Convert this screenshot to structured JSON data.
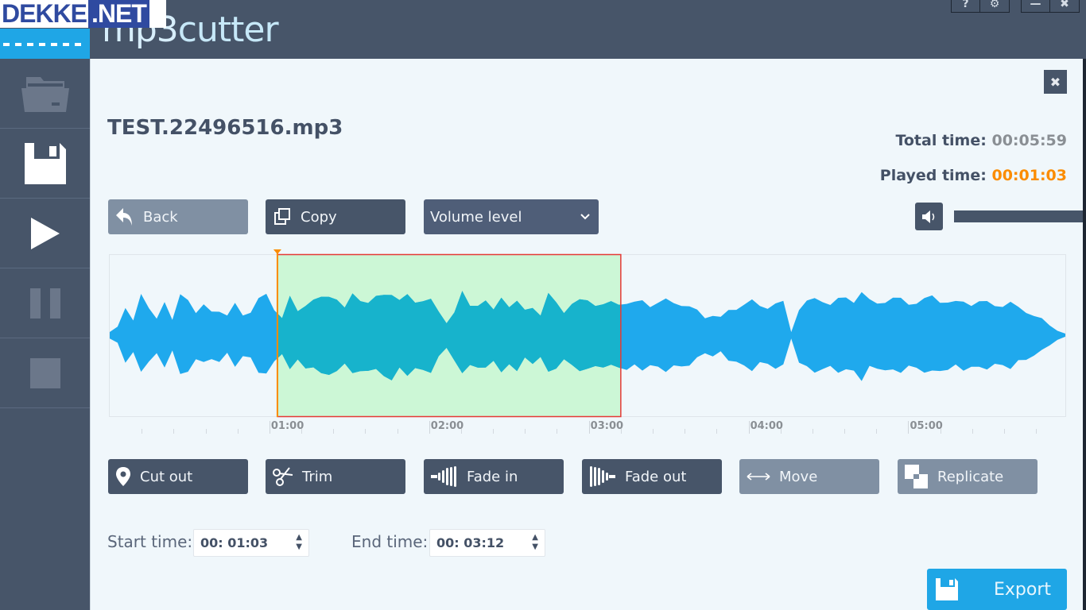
{
  "watermark": {
    "part1": "DEKKE",
    "part2": ".NET"
  },
  "app": {
    "title_prefix": "mp3",
    "title_suffix": "cutter"
  },
  "window_controls": {
    "help": "?",
    "settings": "⚙",
    "minimize": "—",
    "close": "✖"
  },
  "sidebar": {
    "items": [
      {
        "name": "open-file",
        "icon": "folder-icon",
        "enabled": false
      },
      {
        "name": "save",
        "icon": "floppy-disk-icon",
        "enabled": true
      },
      {
        "name": "play",
        "icon": "play-icon",
        "enabled": true
      },
      {
        "name": "pause",
        "icon": "pause-icon",
        "enabled": false
      },
      {
        "name": "stop",
        "icon": "stop-icon",
        "enabled": false
      }
    ]
  },
  "panel": {
    "close_label": "✖"
  },
  "file": {
    "name": "TEST.22496516.mp3"
  },
  "times": {
    "total_label": "Total time:",
    "total_value": "00:05:59",
    "played_label": "Played time:",
    "played_value": "00:01:03"
  },
  "toolbar": {
    "back_label": "Back",
    "copy_label": "Copy",
    "volume_select": {
      "selected": "Volume level"
    }
  },
  "volume": {
    "icon": "speaker-icon"
  },
  "waveform": {
    "total_seconds": 359,
    "selection_start_seconds": 63,
    "selection_end_seconds": 192,
    "playhead_seconds": 63,
    "tick_labels": [
      "01:00",
      "02:00",
      "03:00",
      "04:00",
      "05:00"
    ],
    "colors": {
      "wave": "#1fa9ed",
      "wave_selected": "#17b3cc",
      "selection_fill": "#ccf7d6",
      "selection_border": "#e53935",
      "playhead": "#fb8c00"
    },
    "amplitudes": [
      0.04,
      0.1,
      0.35,
      0.2,
      0.5,
      0.32,
      0.22,
      0.44,
      0.18,
      0.5,
      0.48,
      0.28,
      0.36,
      0.3,
      0.32,
      0.24,
      0.38,
      0.26,
      0.3,
      0.44,
      0.5,
      0.34,
      0.22,
      0.46,
      0.3,
      0.4,
      0.44,
      0.45,
      0.5,
      0.48,
      0.33,
      0.5,
      0.46,
      0.42,
      0.46,
      0.5,
      0.55,
      0.44,
      0.48,
      0.42,
      0.46,
      0.44,
      0.28,
      0.16,
      0.3,
      0.52,
      0.36,
      0.4,
      0.44,
      0.3,
      0.48,
      0.38,
      0.42,
      0.3,
      0.36,
      0.26,
      0.5,
      0.4,
      0.3,
      0.4,
      0.42,
      0.44,
      0.4,
      0.38,
      0.4,
      0.4,
      0.42,
      0.4,
      0.42,
      0.38,
      0.42,
      0.43,
      0.4,
      0.4,
      0.36,
      0.3,
      0.22,
      0.26,
      0.22,
      0.3,
      0.34,
      0.4,
      0.42,
      0.36,
      0.36,
      0.4,
      0.4,
      0.04,
      0.34,
      0.42,
      0.44,
      0.44,
      0.4,
      0.44,
      0.46,
      0.44,
      0.55,
      0.42,
      0.4,
      0.44,
      0.46,
      0.44,
      0.4,
      0.42,
      0.44,
      0.48,
      0.44,
      0.42,
      0.4,
      0.42,
      0.4,
      0.42,
      0.4,
      0.38,
      0.38,
      0.4,
      0.34,
      0.3,
      0.25,
      0.2,
      0.12,
      0.06,
      0.02
    ]
  },
  "actions": [
    {
      "name": "cut-out",
      "label": "Cut out",
      "icon": "map-pin-icon",
      "style": "dark"
    },
    {
      "name": "trim",
      "label": "Trim",
      "icon": "scissors-icon",
      "style": "dark"
    },
    {
      "name": "fade-in",
      "label": "Fade in",
      "icon": "fade-in-icon",
      "style": "dark"
    },
    {
      "name": "fade-out",
      "label": "Fade out",
      "icon": "fade-out-icon",
      "style": "dark"
    },
    {
      "name": "move",
      "label": "Move",
      "icon": "double-arrow-icon",
      "style": "light"
    },
    {
      "name": "replicate",
      "label": "Replicate",
      "icon": "replicate-icon",
      "style": "light"
    }
  ],
  "range": {
    "start_label": "Start time:",
    "start_value": "00: 01:03",
    "end_label": "End time:",
    "end_value": "00: 03:12"
  },
  "export": {
    "label": "Export"
  }
}
